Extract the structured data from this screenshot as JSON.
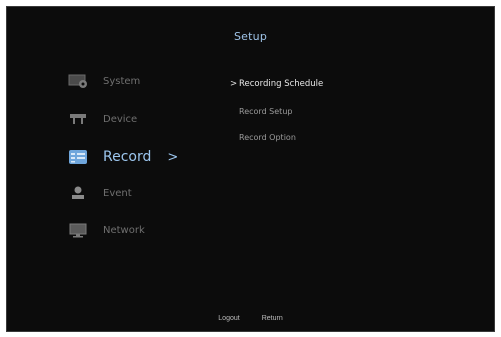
{
  "title": "Setup",
  "menu": [
    {
      "label": "System",
      "icon": "system-icon",
      "active": false
    },
    {
      "label": "Device",
      "icon": "device-icon",
      "active": false
    },
    {
      "label": "Record",
      "icon": "record-icon",
      "active": true,
      "arrow": ">"
    },
    {
      "label": "Event",
      "icon": "event-icon",
      "active": false
    },
    {
      "label": "Network",
      "icon": "network-icon",
      "active": false
    }
  ],
  "submenu": [
    {
      "label": "Recording Schedule",
      "selected": true,
      "arrow": ">"
    },
    {
      "label": "Record Setup",
      "selected": false
    },
    {
      "label": "Record Option",
      "selected": false
    }
  ],
  "footer": {
    "logout_label": "Logout",
    "return_label": "Return"
  },
  "colors": {
    "background": "#0c0c0c",
    "accent": "#9cc6ee",
    "inactive": "#6f6f6f",
    "submenu_text": "#9b9b9b",
    "selected_text": "#e8e8e8"
  }
}
